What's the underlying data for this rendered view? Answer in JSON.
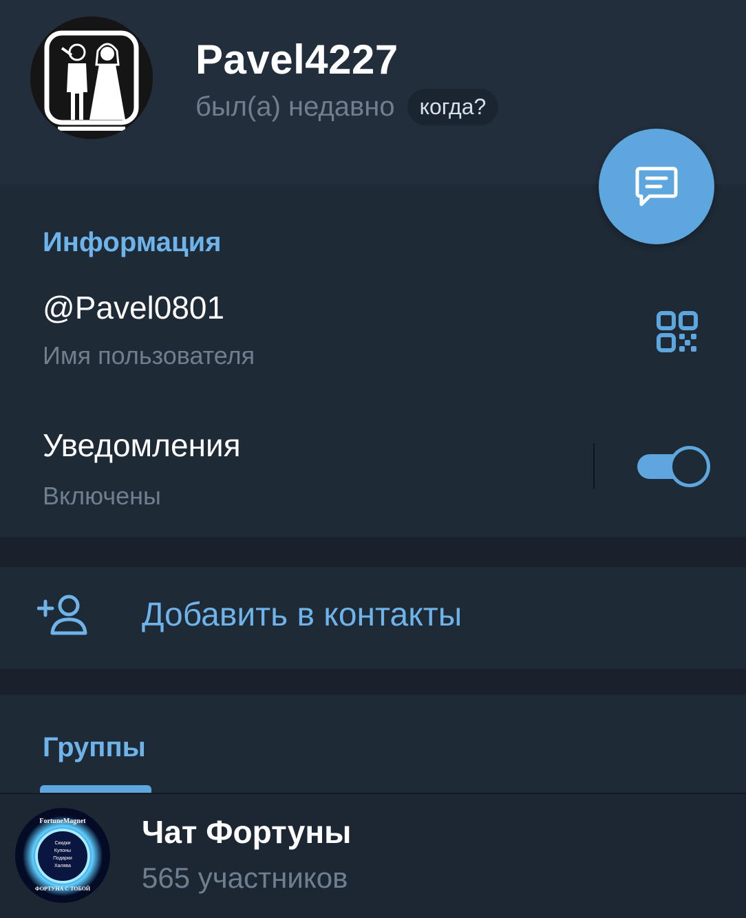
{
  "profile": {
    "name": "Pavel4227",
    "status": "был(а) недавно",
    "when_label": "когда?"
  },
  "info": {
    "section_title": "Информация",
    "username": "@Pavel0801",
    "username_caption": "Имя пользователя",
    "notifications_label": "Уведомления",
    "notifications_state": "Включены",
    "notifications_enabled": true
  },
  "actions": {
    "add_contact_label": "Добавить в контакты"
  },
  "groups": {
    "section_title": "Группы",
    "items": [
      {
        "name": "Чат Фортуны",
        "members": "565 участников",
        "avatar_text_top": "FortuneMagnet",
        "avatar_lines": [
          "Скидки",
          "Купоны",
          "Подарки",
          "Халява"
        ],
        "avatar_text_bottom": "ФОРТУНА С ТОБОЙ"
      }
    ]
  },
  "colors": {
    "accent": "#5ea6de",
    "header_bg": "#232e3c",
    "section_bg": "#1f2a37",
    "link_text": "#6eb4ea"
  }
}
